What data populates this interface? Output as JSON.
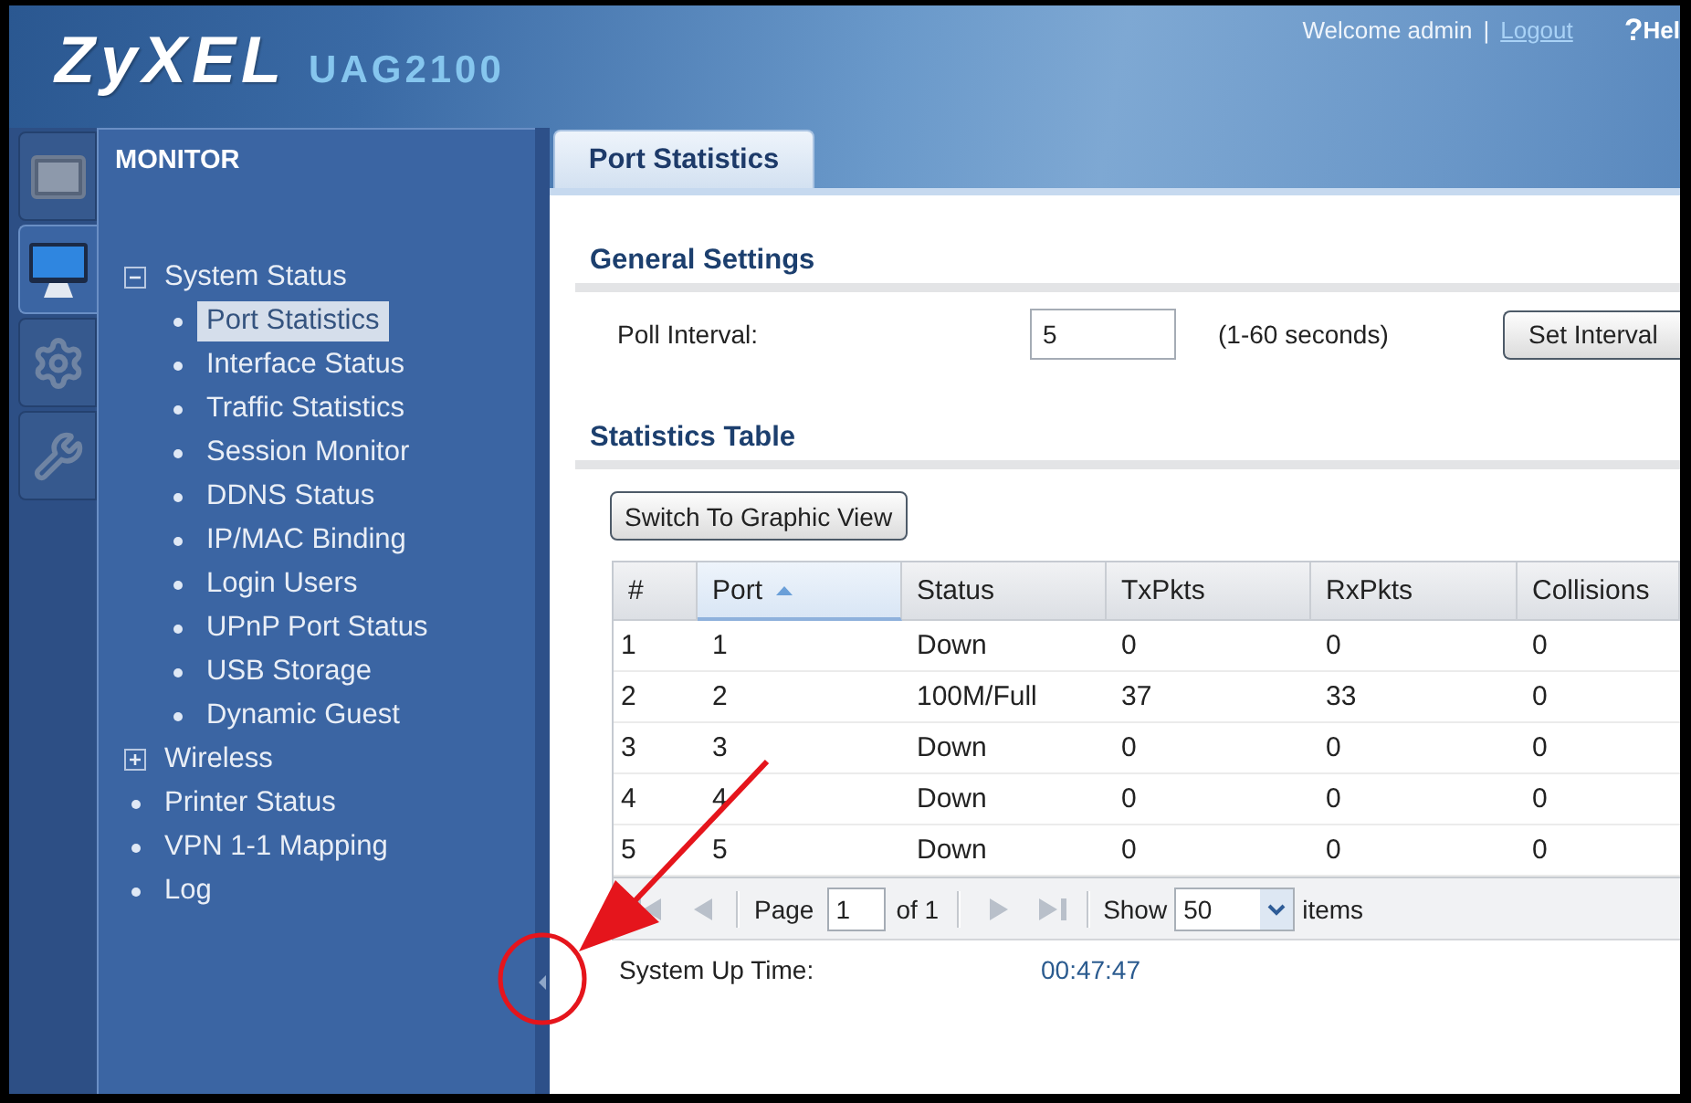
{
  "header": {
    "logo": "ZyXEL",
    "model": "UAG2100",
    "welcome": "Welcome admin",
    "separator": "|",
    "logout": "Logout",
    "help_icon": "?",
    "help": "Hel"
  },
  "side_icons": [
    {
      "kind": "dashboard",
      "selected": false
    },
    {
      "kind": "monitor",
      "selected": true
    },
    {
      "kind": "gear",
      "selected": false
    },
    {
      "kind": "tools",
      "selected": false
    }
  ],
  "sidebar": {
    "title": "MONITOR",
    "items": [
      {
        "kind": "group",
        "label": "System Status",
        "expanded": true,
        "selected": false,
        "children": [
          {
            "label": "Port Statistics",
            "selected": true
          },
          {
            "label": "Interface Status",
            "selected": false
          },
          {
            "label": "Traffic Statistics",
            "selected": false
          },
          {
            "label": "Session Monitor",
            "selected": false
          },
          {
            "label": "DDNS Status",
            "selected": false
          },
          {
            "label": "IP/MAC Binding",
            "selected": false
          },
          {
            "label": "Login Users",
            "selected": false
          },
          {
            "label": "UPnP Port Status",
            "selected": false
          },
          {
            "label": "USB Storage",
            "selected": false
          },
          {
            "label": "Dynamic Guest",
            "selected": false
          }
        ]
      },
      {
        "kind": "group",
        "label": "Wireless",
        "expanded": false,
        "selected": false
      },
      {
        "kind": "link",
        "label": "Printer Status",
        "selected": false
      },
      {
        "kind": "link",
        "label": "VPN 1-1 Mapping",
        "selected": false
      },
      {
        "kind": "link",
        "label": "Log",
        "selected": false
      }
    ]
  },
  "tabs": [
    {
      "label": "Port Statistics",
      "selected": true
    }
  ],
  "general_settings": {
    "title": "General Settings",
    "poll_label": "Poll Interval:",
    "poll_value": "5",
    "poll_hint": "(1-60 seconds)",
    "set_button": "Set Interval"
  },
  "statistics_table": {
    "title": "Statistics Table",
    "view_button": "Switch To Graphic View",
    "columns": [
      {
        "label": "#",
        "sorted": false
      },
      {
        "label": "Port",
        "sorted": true
      },
      {
        "label": "Status",
        "sorted": false
      },
      {
        "label": "TxPkts",
        "sorted": false
      },
      {
        "label": "RxPkts",
        "sorted": false
      },
      {
        "label": "Collisions",
        "sorted": false
      }
    ],
    "rows": [
      [
        "1",
        "1",
        "Down",
        "0",
        "0",
        "0"
      ],
      [
        "2",
        "2",
        "100M/Full",
        "37",
        "33",
        "0"
      ],
      [
        "3",
        "3",
        "Down",
        "0",
        "0",
        "0"
      ],
      [
        "4",
        "4",
        "Down",
        "0",
        "0",
        "0"
      ],
      [
        "5",
        "5",
        "Down",
        "0",
        "0",
        "0"
      ]
    ],
    "pager": {
      "back_buttons": [
        {
          "kind": "first",
          "disabled": true
        },
        {
          "kind": "previous",
          "disabled": true
        }
      ],
      "page_label": "Page",
      "page": "1",
      "page_total": "of 1",
      "forward_buttons": [
        {
          "kind": "next",
          "disabled": true
        },
        {
          "kind": "last",
          "disabled": true
        }
      ],
      "show_label": "Show",
      "show_value": "50",
      "items_label": "items"
    }
  },
  "system_up_time": {
    "label": "System Up Time:",
    "value": "00:47:47"
  }
}
